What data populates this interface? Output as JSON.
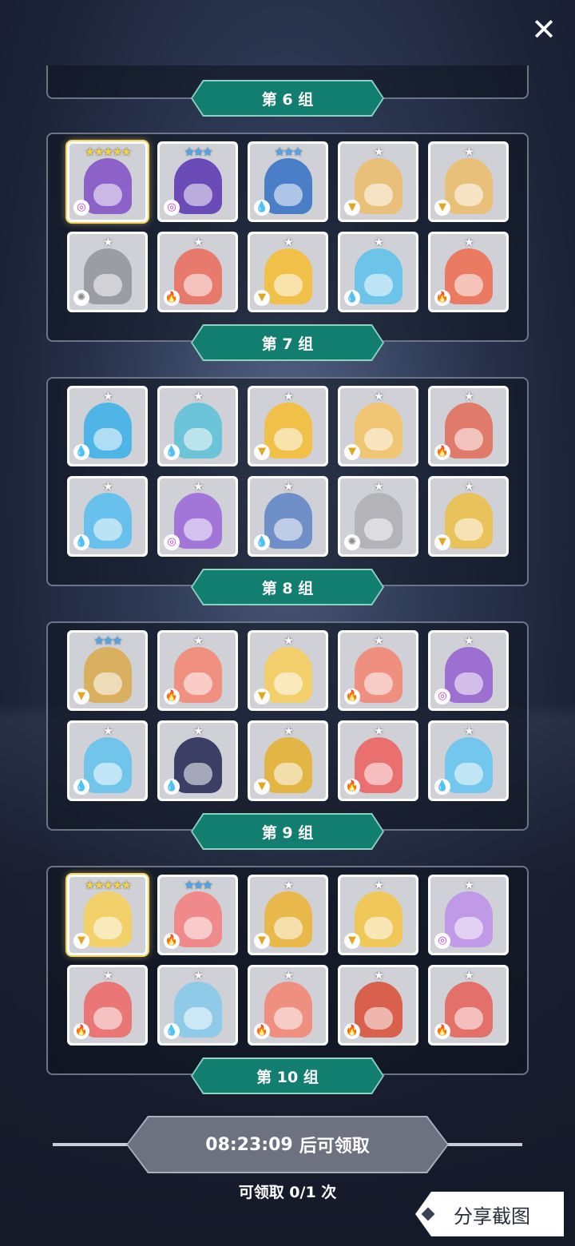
{
  "close_icon": "close-icon",
  "elements": {
    "water": {
      "glyph": "💧",
      "color": "#2f8fe0"
    },
    "fire": {
      "glyph": "🔥",
      "color": "#e8572c"
    },
    "wind": {
      "glyph": "▼",
      "color": "#e3a621"
    },
    "dark": {
      "glyph": "◎",
      "color": "#c43bd0"
    },
    "light": {
      "glyph": "✺",
      "color": "#8a8a8a"
    }
  },
  "groups": [
    {
      "label": "第 7 组",
      "heroes": [
        {
          "stars": "★★★★★",
          "star_color": "#f6d24a",
          "element": "dark",
          "color": "#8c62c9",
          "gold": true
        },
        {
          "stars": "★★★",
          "star_color": "#4aa8f0",
          "element": "dark",
          "color": "#6a4bb8"
        },
        {
          "stars": "★★★",
          "star_color": "#4aa8f0",
          "element": "water",
          "color": "#4a7fc7"
        },
        {
          "stars": "★",
          "star_color": "#ffffff",
          "element": "wind",
          "color": "#e8c07a"
        },
        {
          "stars": "★",
          "star_color": "#ffffff",
          "element": "wind",
          "color": "#e8c07a"
        },
        {
          "stars": "★",
          "star_color": "#ffffff",
          "element": "light",
          "color": "#9c9ca4"
        },
        {
          "stars": "★",
          "star_color": "#ffffff",
          "element": "fire",
          "color": "#e77a6d"
        },
        {
          "stars": "★",
          "star_color": "#ffffff",
          "element": "wind",
          "color": "#f1c048"
        },
        {
          "stars": "★",
          "star_color": "#ffffff",
          "element": "water",
          "color": "#6ec4e8"
        },
        {
          "stars": "★",
          "star_color": "#ffffff",
          "element": "fire",
          "color": "#ea7a62"
        }
      ]
    },
    {
      "label": "第 8 组",
      "heroes": [
        {
          "stars": "★",
          "star_color": "#ffffff",
          "element": "water",
          "color": "#4fb5e6"
        },
        {
          "stars": "★",
          "star_color": "#ffffff",
          "element": "water",
          "color": "#6cc4d8"
        },
        {
          "stars": "★",
          "star_color": "#ffffff",
          "element": "wind",
          "color": "#f1c048"
        },
        {
          "stars": "★",
          "star_color": "#ffffff",
          "element": "wind",
          "color": "#f0c574"
        },
        {
          "stars": "★",
          "star_color": "#ffffff",
          "element": "fire",
          "color": "#e07a6a"
        },
        {
          "stars": "★",
          "star_color": "#ffffff",
          "element": "water",
          "color": "#68c0ec"
        },
        {
          "stars": "★",
          "star_color": "#ffffff",
          "element": "dark",
          "color": "#a275d8"
        },
        {
          "stars": "★",
          "star_color": "#ffffff",
          "element": "water",
          "color": "#6f8fc8"
        },
        {
          "stars": "★",
          "star_color": "#ffffff",
          "element": "light",
          "color": "#b3b3b8"
        },
        {
          "stars": "★",
          "star_color": "#ffffff",
          "element": "wind",
          "color": "#e9c25c"
        }
      ]
    },
    {
      "label": "第 9 组",
      "heroes": [
        {
          "stars": "★★★",
          "star_color": "#4aa8f0",
          "element": "wind",
          "color": "#d9b060"
        },
        {
          "stars": "★",
          "star_color": "#ffffff",
          "element": "fire",
          "color": "#f09080"
        },
        {
          "stars": "★",
          "star_color": "#ffffff",
          "element": "wind",
          "color": "#f2cf6a"
        },
        {
          "stars": "★",
          "star_color": "#ffffff",
          "element": "fire",
          "color": "#ef8f80"
        },
        {
          "stars": "★",
          "star_color": "#ffffff",
          "element": "dark",
          "color": "#9d6fd0"
        },
        {
          "stars": "★",
          "star_color": "#ffffff",
          "element": "water",
          "color": "#72c5ea"
        },
        {
          "stars": "★",
          "star_color": "#ffffff",
          "element": "water",
          "color": "#3b3f66"
        },
        {
          "stars": "★",
          "star_color": "#ffffff",
          "element": "wind",
          "color": "#e3b545"
        },
        {
          "stars": "★",
          "star_color": "#ffffff",
          "element": "fire",
          "color": "#ea7070"
        },
        {
          "stars": "★",
          "star_color": "#ffffff",
          "element": "water",
          "color": "#73c6ee"
        }
      ]
    },
    {
      "label": "第 10 组",
      "heroes": [
        {
          "stars": "★★★★★",
          "star_color": "#f6d24a",
          "element": "wind",
          "color": "#f2d06a",
          "gold": true
        },
        {
          "stars": "★★★",
          "star_color": "#4aa8f0",
          "element": "fire",
          "color": "#f08a8a"
        },
        {
          "stars": "★",
          "star_color": "#ffffff",
          "element": "wind",
          "color": "#e8b84a"
        },
        {
          "stars": "★",
          "star_color": "#ffffff",
          "element": "wind",
          "color": "#f0c85a"
        },
        {
          "stars": "★",
          "star_color": "#ffffff",
          "element": "dark",
          "color": "#c09ae6"
        },
        {
          "stars": "★",
          "star_color": "#ffffff",
          "element": "fire",
          "color": "#ea7676"
        },
        {
          "stars": "★",
          "star_color": "#ffffff",
          "element": "water",
          "color": "#8fcbe8"
        },
        {
          "stars": "★",
          "star_color": "#ffffff",
          "element": "fire",
          "color": "#ef8f80"
        },
        {
          "stars": "★",
          "star_color": "#ffffff",
          "element": "fire",
          "color": "#d9604c"
        },
        {
          "stars": "★",
          "star_color": "#ffffff",
          "element": "fire",
          "color": "#e4706a"
        }
      ]
    }
  ],
  "top_label": "第 6 组",
  "timer": {
    "countdown": "08:23:09",
    "suffix": "后可领取"
  },
  "claim_count": "可领取 0/1 次",
  "share_label": "分享截图"
}
